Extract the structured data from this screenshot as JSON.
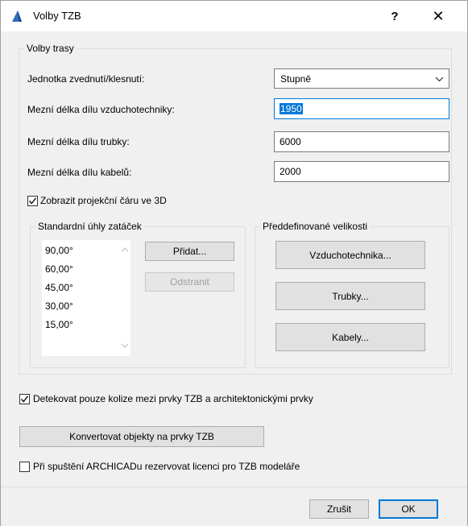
{
  "window": {
    "title": "Volby TZB",
    "help": "?",
    "close": "✕"
  },
  "routing": {
    "legend": "Volby trasy",
    "rise_unit_label": "Jednotka zvednutí/klesnutí:",
    "rise_unit_value": "Stupně",
    "duct_label": "Mezní délka dílu vzduchotechniky:",
    "duct_value": "1950",
    "pipe_label": "Mezní délka dílu trubky:",
    "pipe_value": "6000",
    "cable_label": "Mezní délka dílu kabelů:",
    "cable_value": "2000",
    "show_projection_label": "Zobrazit projekční čáru ve 3D",
    "show_projection_checked": true
  },
  "angles": {
    "legend": "Standardní úhly zatáček",
    "items": [
      "90,00°",
      "60,00°",
      "45,00°",
      "30,00°",
      "15,00°"
    ],
    "add_label": "Přidat...",
    "remove_label": "Odstranit"
  },
  "sizes": {
    "legend": "Předdefinované velikosti",
    "ducts_label": "Vzduchotechnika...",
    "pipes_label": "Trubky...",
    "cables_label": "Kabely..."
  },
  "options": {
    "collision_label": "Detekovat pouze kolize mezi prvky TZB a architektonickými prvky",
    "collision_checked": true,
    "convert_label": "Konvertovat objekty na prvky TZB",
    "reserve_label": "Při spuštění ARCHICADu rezervovat licenci pro TZB modeláře",
    "reserve_checked": false
  },
  "footer": {
    "cancel_label": "Zrušit",
    "ok_label": "OK"
  },
  "colors": {
    "accent": "#0078d7",
    "disabled_text": "#a0a0a0",
    "background": "#f0f0f0"
  }
}
